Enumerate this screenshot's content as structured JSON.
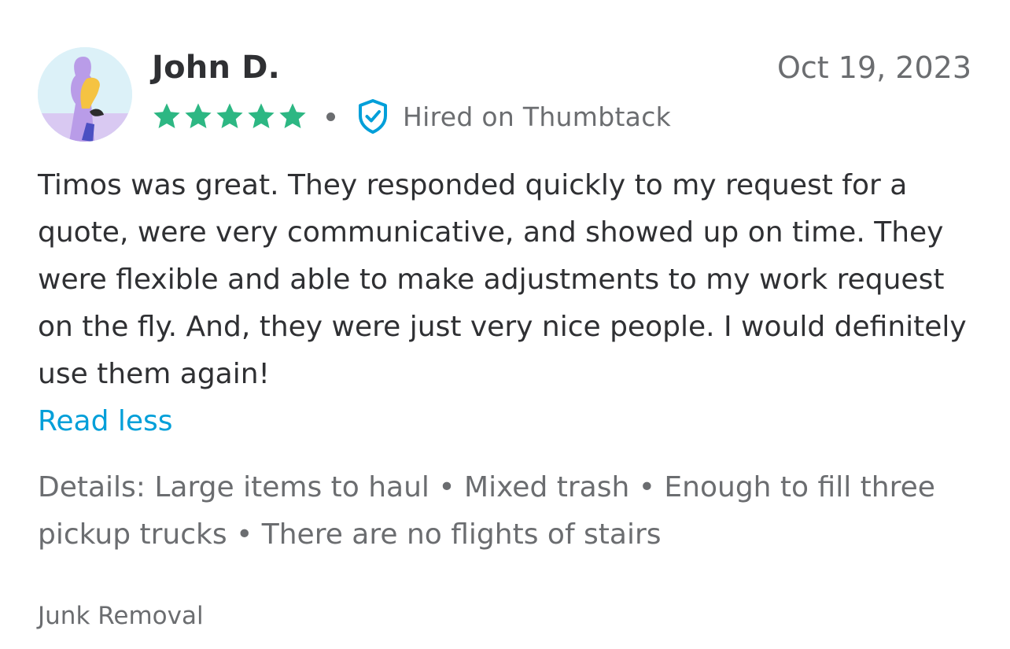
{
  "review": {
    "reviewer_name": "John D.",
    "date": "Oct 19, 2023",
    "rating": 5,
    "star_color": "#2db783",
    "hired_icon": "shield-check-icon",
    "hired_label": "Hired on Thumbtack",
    "text": "Timos was great. They responded quickly to my request for a quote, were very communicative, and showed up on time. They were flexible and able to make adjustments to my work request on the fly. And, they were just very nice people. I would definitely use them again!",
    "read_less_label": "Read less",
    "details": "Details: Large items to haul • Mixed trash • Enough to fill three pickup trucks • There are no flights of stairs",
    "category": "Junk Removal"
  },
  "colors": {
    "link": "#009fd9",
    "muted_text": "#6b6d70",
    "primary_text": "#2f3033",
    "shield": "#009fd9"
  }
}
